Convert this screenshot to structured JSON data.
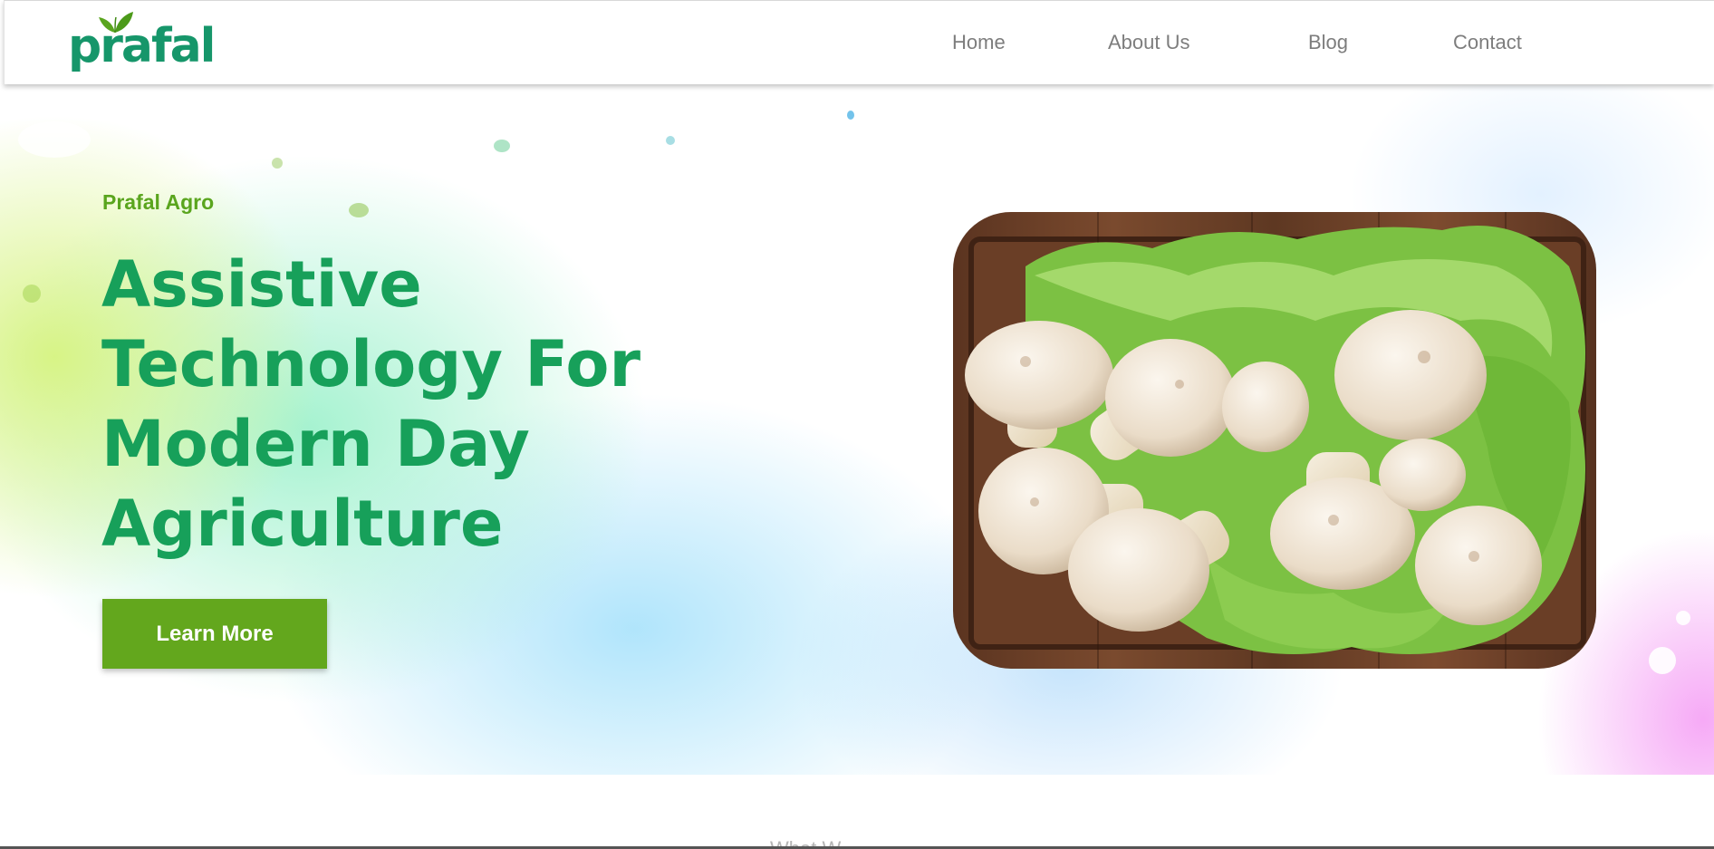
{
  "brand": {
    "name": "prafal",
    "color": "#16966a",
    "leaf_color": "#5aa51e"
  },
  "nav": {
    "items": [
      {
        "label": "Home"
      },
      {
        "label": "About Us"
      },
      {
        "label": "Blog"
      },
      {
        "label": "Contact"
      }
    ],
    "text_color": "#7d7d7d"
  },
  "hero": {
    "eyebrow": "Prafal Agro",
    "headline_lines": [
      "Assistive",
      "Technology For",
      "Modern Day",
      "Agriculture"
    ],
    "cta_label": "Learn More",
    "headline_color": "#17a05a",
    "cta_color": "#63a71d",
    "image": {
      "subject": "white button mushrooms on green lettuce on a wooden tray",
      "icon": "photo"
    }
  },
  "next_section": {
    "partial_heading": "What W"
  }
}
